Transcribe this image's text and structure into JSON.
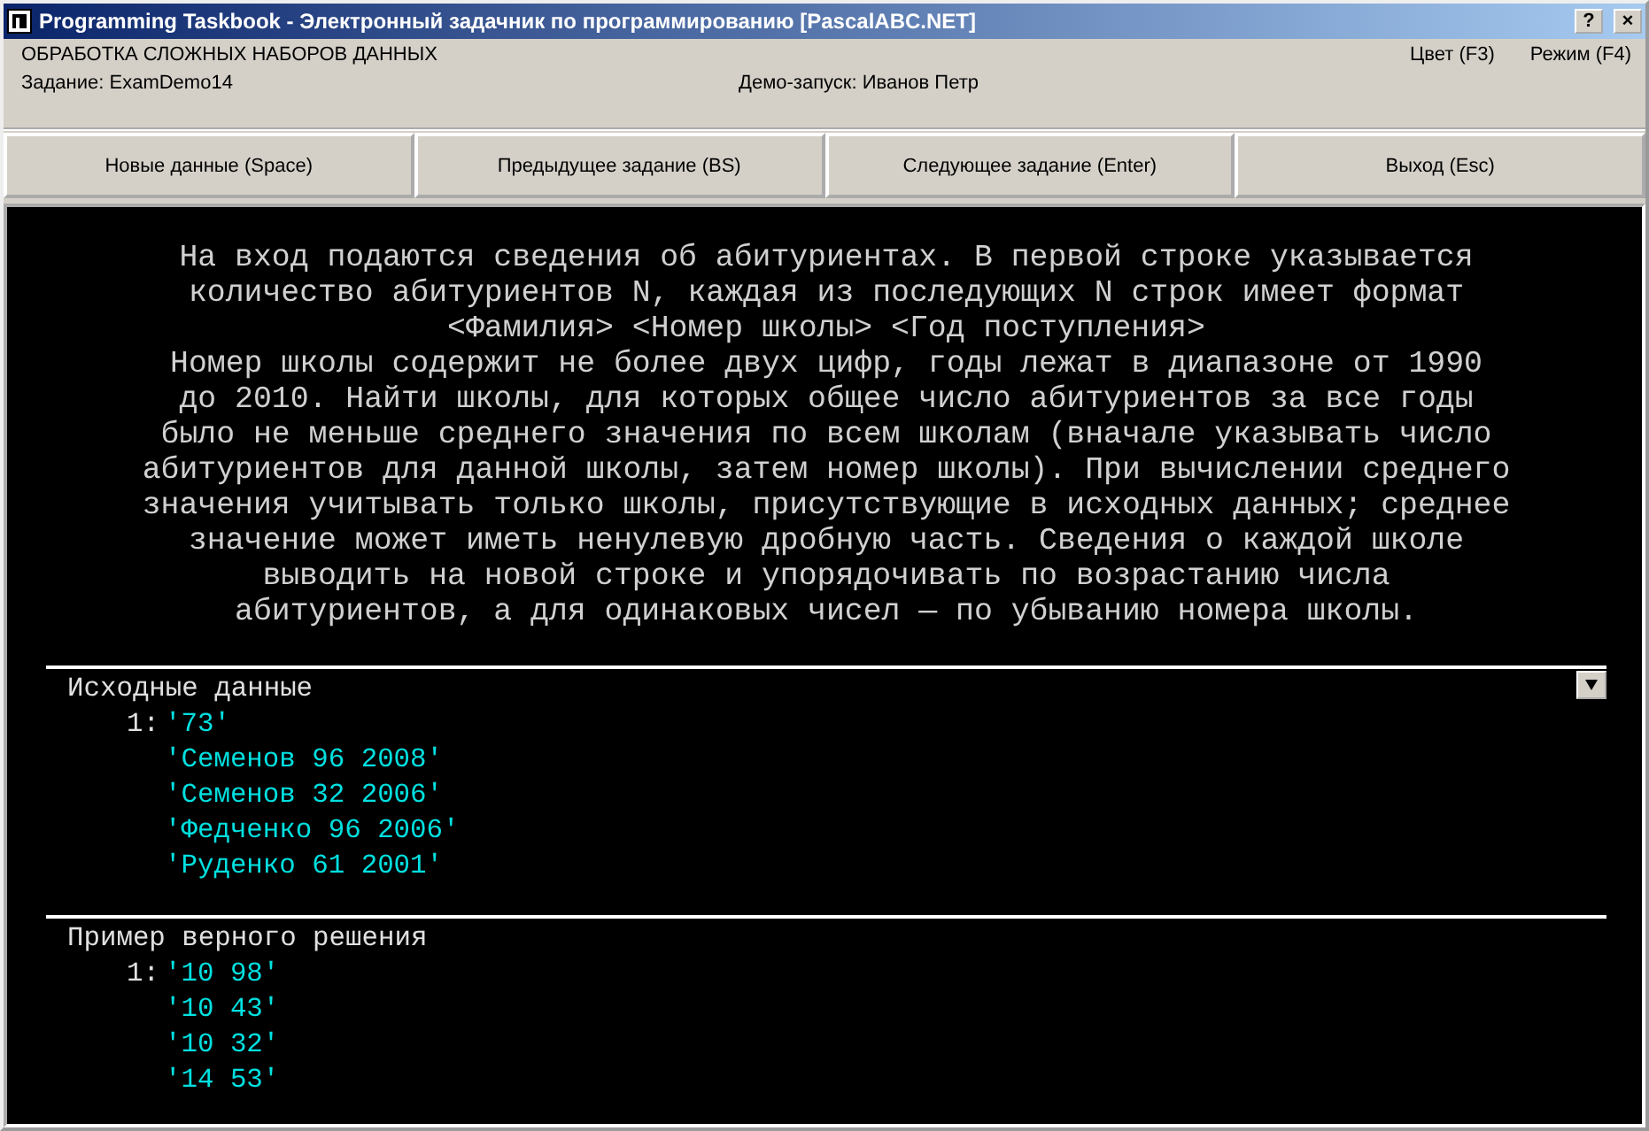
{
  "window": {
    "title": "Programming Taskbook - Электронный задачник по программированию [PascalABC.NET]",
    "controls": [
      "?",
      "×"
    ]
  },
  "header": {
    "group": "ОБРАБОТКА СЛОЖНЫХ НАБОРОВ ДАННЫХ",
    "task": "Задание: ExamDemo14",
    "demo": "Демо-запуск: Иванов Петр",
    "color_key": "Цвет (F3)",
    "mode_key": "Режим (F4)"
  },
  "buttons": [
    "Новые данные (Space)",
    "Предыдущее задание (BS)",
    "Следующее задание (Enter)",
    "Выход (Esc)"
  ],
  "description": [
    "На вход подаются сведения об абитуриентах. В первой строке указывается",
    "количество абитуриентов N, каждая из последующих N строк имеет формат",
    "<Фамилия> <Номер школы> <Год поступления>",
    "Номер школы содержит не более двух цифр, годы лежат в диапазоне от 1990",
    "до 2010. Найти школы, для которых общее число абитуриентов за все годы",
    "было не меньше среднего значения по всем школам (вначале указывать число",
    "абитуриентов для данной школы, затем номер школы). При вычислении среднего",
    "значения учитывать только школы, присутствующие в исходных данных; среднее",
    "значение может иметь ненулевую дробную часть. Сведения о каждой школе",
    "выводить на новой строке и упорядочивать по возрастанию числа",
    "абитуриентов, а для одинаковых чисел — по убыванию номера школы."
  ],
  "sections": [
    {
      "title": "Исходные данные",
      "menu_button": true,
      "file_label": "1:",
      "lines": [
        "'73'",
        "'Семенов 96 2008'",
        "'Семенов 32 2006'",
        "'Федченко 96 2006'",
        "'Руденко 61 2001'"
      ]
    },
    {
      "title": "Пример верного решения",
      "menu_button": false,
      "file_label": "1:",
      "lines": [
        "'10 98'",
        "'10 43'",
        "'10 32'",
        "'14 53'"
      ]
    }
  ]
}
